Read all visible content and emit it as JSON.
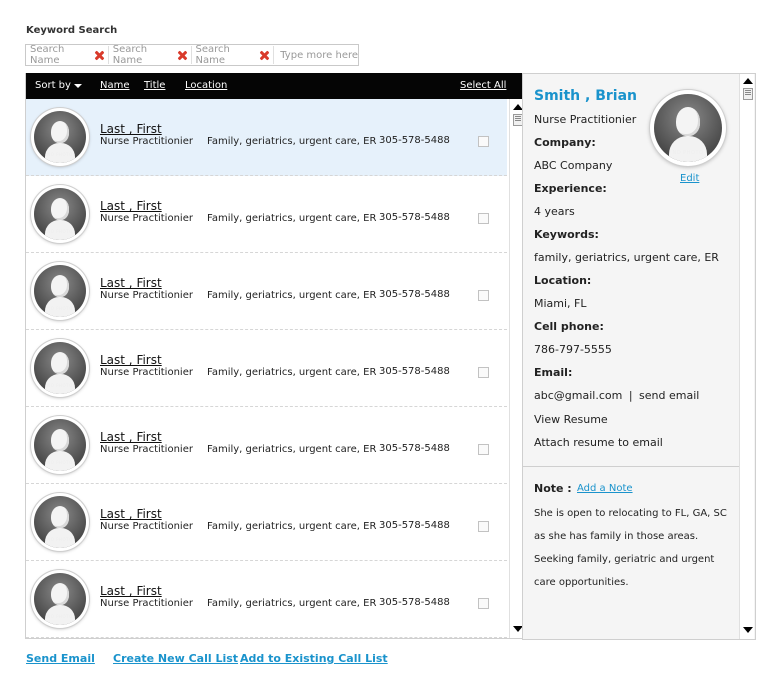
{
  "search": {
    "label": "Keyword Search",
    "chips": [
      "Search Name",
      "Search Name",
      "Search Name"
    ],
    "placeholder": "Type more here"
  },
  "list": {
    "header": {
      "sort_by": "Sort by",
      "name": "Name",
      "title": "Title",
      "location": "Location",
      "select_all": "Select All"
    },
    "no_photo": "NO PHOTO",
    "rows": [
      {
        "name": "Last , First",
        "title": "Nurse Practitionier",
        "keywords": "Family, geriatrics, urgent care, ER",
        "phone": "305-578-5488",
        "selected": true
      },
      {
        "name": "Last , First",
        "title": "Nurse Practitionier",
        "keywords": "Family, geriatrics, urgent care, ER",
        "phone": "305-578-5488",
        "selected": false
      },
      {
        "name": "Last , First",
        "title": "Nurse Practitionier",
        "keywords": "Family, geriatrics, urgent care, ER",
        "phone": "305-578-5488",
        "selected": false
      },
      {
        "name": "Last , First",
        "title": "Nurse Practitionier",
        "keywords": "Family, geriatrics, urgent care, ER",
        "phone": "305-578-5488",
        "selected": false
      },
      {
        "name": "Last , First",
        "title": "Nurse Practitionier",
        "keywords": "Family, geriatrics, urgent care, ER",
        "phone": "305-578-5488",
        "selected": false
      },
      {
        "name": "Last , First",
        "title": "Nurse Practitionier",
        "keywords": "Family, geriatrics, urgent care, ER",
        "phone": "305-578-5488",
        "selected": false
      },
      {
        "name": "Last , First",
        "title": "Nurse Practitionier",
        "keywords": "Family, geriatrics, urgent care, ER",
        "phone": "305-578-5488",
        "selected": false
      }
    ]
  },
  "detail": {
    "name": "Smith , Brian",
    "title": "Nurse Practitionier",
    "edit": "Edit",
    "no_photo": "NO PHOTO",
    "company_label": "Company:",
    "company": "ABC Company",
    "experience_label": "Experience:",
    "experience": "4 years",
    "keywords_label": "Keywords:",
    "keywords": "family, geriatrics, urgent care, ER",
    "location_label": "Location:",
    "location": "Miami, FL",
    "cell_label": "Cell phone:",
    "cell": "786-797-5555",
    "email_label": "Email:",
    "email": "abc@gmail.com",
    "email_sep": "|",
    "send_email": "send email",
    "view_resume": "View Resume",
    "attach_resume": "Attach resume to email",
    "note_label": "Note :",
    "add_note": "Add a Note",
    "note_lines": [
      "She is open to relocating to FL, GA, SC",
      "as she has family in those areas.",
      "Seeking family, geriatric and urgent",
      "care opportunities."
    ]
  },
  "footer": {
    "send_email": "Send Email",
    "create_call_list": "Create New Call List",
    "add_existing_call_list": "Add to Existing Call List"
  },
  "colors": {
    "accent": "#1a93cc",
    "header_bg": "#050505",
    "selected_row": "#e6f1fb",
    "remove_x": "#d93a2b"
  }
}
